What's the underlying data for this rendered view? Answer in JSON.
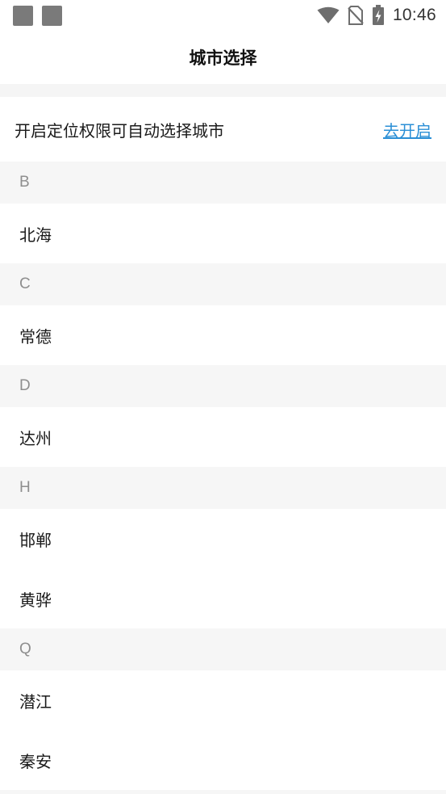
{
  "status_bar": {
    "time": "10:46",
    "icons": [
      "notification-square",
      "notification-square",
      "wifi-icon",
      "no-sim-icon",
      "battery-charging-icon"
    ],
    "icon_color": "#7a7a7a"
  },
  "header": {
    "title": "城市选择"
  },
  "location_banner": {
    "text": "开启定位权限可自动选择城市",
    "action_label": "去开启",
    "action_color": "#2b8fd6"
  },
  "city_groups": [
    {
      "letter": "B",
      "cities": [
        "北海"
      ]
    },
    {
      "letter": "C",
      "cities": [
        "常德"
      ]
    },
    {
      "letter": "D",
      "cities": [
        "达州"
      ]
    },
    {
      "letter": "H",
      "cities": [
        "邯郸",
        "黄骅"
      ]
    },
    {
      "letter": "Q",
      "cities": [
        "潜江",
        "秦安"
      ]
    }
  ],
  "colors": {
    "background": "#ffffff",
    "section_background": "#f6f6f6",
    "section_letter": "#8e8e8e",
    "text": "#1a1a1a"
  }
}
